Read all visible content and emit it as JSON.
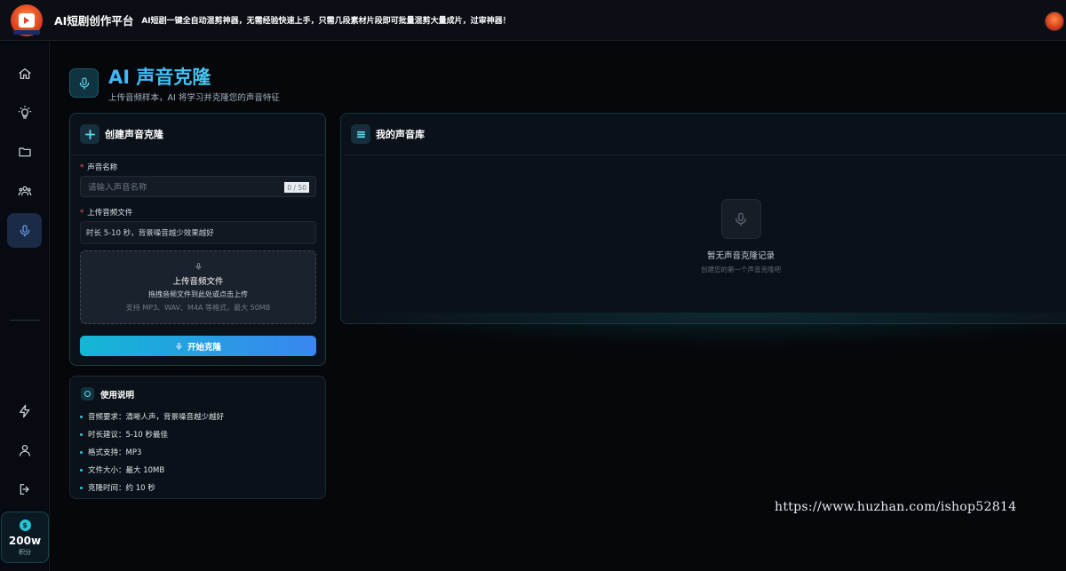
{
  "header": {
    "app_title": "AI短剧创作平台",
    "slogan": "AI短剧一键全自动混剪神器，无需经验快速上手，只需几段素材片段即可批量混剪大量成片，过审神器！"
  },
  "sidebar": {
    "items": [
      {
        "icon": "home-icon"
      },
      {
        "icon": "lightbulb-icon"
      },
      {
        "icon": "folder-icon"
      },
      {
        "icon": "users-icon"
      },
      {
        "icon": "microphone-icon",
        "active": true
      },
      {
        "icon": "lightning-icon"
      },
      {
        "icon": "user-icon"
      },
      {
        "icon": "logout-icon"
      }
    ],
    "credits": {
      "symbol": "$",
      "value": "200w",
      "unit": "积分"
    }
  },
  "page": {
    "title": "AI 声音克隆",
    "subtitle": "上传音频样本，AI 将学习并克隆您的声音特征"
  },
  "create_card": {
    "title": "创建声音克隆",
    "name_label": "声音名称",
    "name_placeholder": "请输入声音名称",
    "name_counter": "0 / 50",
    "file_label": "上传音频文件",
    "file_hint": "时长 5-10 秒，背景噪音越少效果越好",
    "dropzone": {
      "title": "上传音频文件",
      "desc": "拖拽音频文件到此处或点击上传",
      "formats": "支持 MP3、WAV、M4A 等格式，最大 50MB"
    },
    "start_button": "开始克隆",
    "required_mark": "*"
  },
  "guide": {
    "title": "使用说明",
    "items": [
      "音频要求：清晰人声，背景噪音越少越好",
      "时长建议：5-10 秒最佳",
      "格式支持：MP3",
      "文件大小：最大 10MB",
      "克隆时间：约 10 秒"
    ]
  },
  "library": {
    "title": "我的声音库",
    "empty_title": "暂无声音克隆记录",
    "empty_desc": "创建您的第一个声音克隆吧"
  },
  "watermark": "https://www.huzhan.com/ishop52814",
  "colors": {
    "accent": "#3ec9f0",
    "button_start": "#12b7d4",
    "button_end": "#3a86f0",
    "background": "#05070b"
  }
}
